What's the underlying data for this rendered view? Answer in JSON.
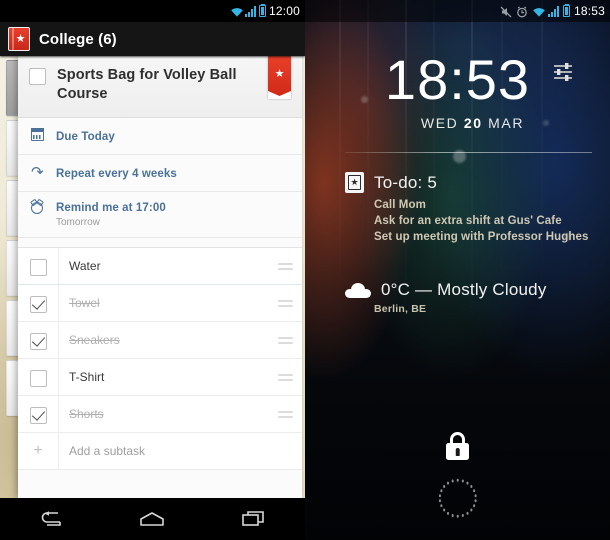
{
  "left_phone": {
    "status_bar": {
      "time": "12:00",
      "icons": [
        "wifi-icon",
        "signal-icon",
        "battery-icon"
      ]
    },
    "action_bar": {
      "app_icon": "wunderlist-book-icon",
      "star_glyph": "★",
      "title": "College (6)"
    },
    "task": {
      "title": "Sports Bag for Volley Ball Course",
      "checkbox_checked": false,
      "starred": true,
      "star_glyph": "★"
    },
    "meta_rows": [
      {
        "icon": "calendar-icon",
        "main": "Due Today",
        "sub": ""
      },
      {
        "icon": "repeat-icon",
        "main": "Repeat every 4 weeks",
        "sub": ""
      },
      {
        "icon": "alarm-icon",
        "main": "Remind me at 17:00",
        "sub": "Tomorrow"
      }
    ],
    "subtasks": [
      {
        "label": "Water",
        "done": false
      },
      {
        "label": "Towel",
        "done": true
      },
      {
        "label": "Sneakers",
        "done": true
      },
      {
        "label": "T-Shirt",
        "done": false
      },
      {
        "label": "Shorts",
        "done": true
      }
    ],
    "add_subtask": {
      "label": "Add a subtask",
      "plus_glyph": "+"
    },
    "nav_bar": {
      "back": "back-icon",
      "home": "home-icon",
      "recents": "recent-apps-icon"
    }
  },
  "right_phone": {
    "status_bar": {
      "time": "18:53",
      "icons": [
        "mute-icon",
        "alarm-icon",
        "wifi-icon",
        "signal-icon",
        "battery-icon"
      ]
    },
    "clock": {
      "time": "18:53",
      "weekday": "WED",
      "day": "20",
      "month": "MAR",
      "settings_icon": "sliders-icon"
    },
    "todo_widget": {
      "icon": "wunderlist-badge-icon",
      "star_glyph": "★",
      "title": "To-do: 5",
      "items": [
        "Call Mom",
        "Ask for an extra shift at Gus' Cafe",
        "Set up meeting with Professor Hughes"
      ]
    },
    "weather_widget": {
      "icon": "cloud-icon",
      "title": "0°C — Mostly Cloudy",
      "location": "Berlin, BE"
    },
    "lock": {
      "icon": "lock-icon",
      "ring": "unlock-ring"
    }
  },
  "colors": {
    "accent_red": "#e8402a",
    "meta_blue": "#4a7199",
    "status_cyan": "#33b5e5",
    "card_bg": "#fbfbfb",
    "action_bar": "#151515"
  }
}
